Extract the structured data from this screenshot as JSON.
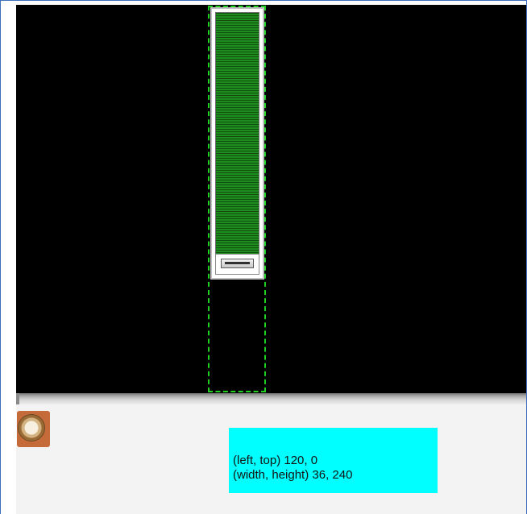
{
  "info": {
    "position_text": "(left, top) 120, 0",
    "size_text": "(width, height) 36, 240"
  },
  "colors": {
    "canvas_background": "#000000",
    "selection_outline": "#20d020",
    "slider_track": "#1e8c1e",
    "info_background": "#00ffff",
    "panel_background": "#f3f3f3",
    "frame_border": "#3f6fb8"
  },
  "icons": {
    "knob": "round-knob-icon"
  }
}
